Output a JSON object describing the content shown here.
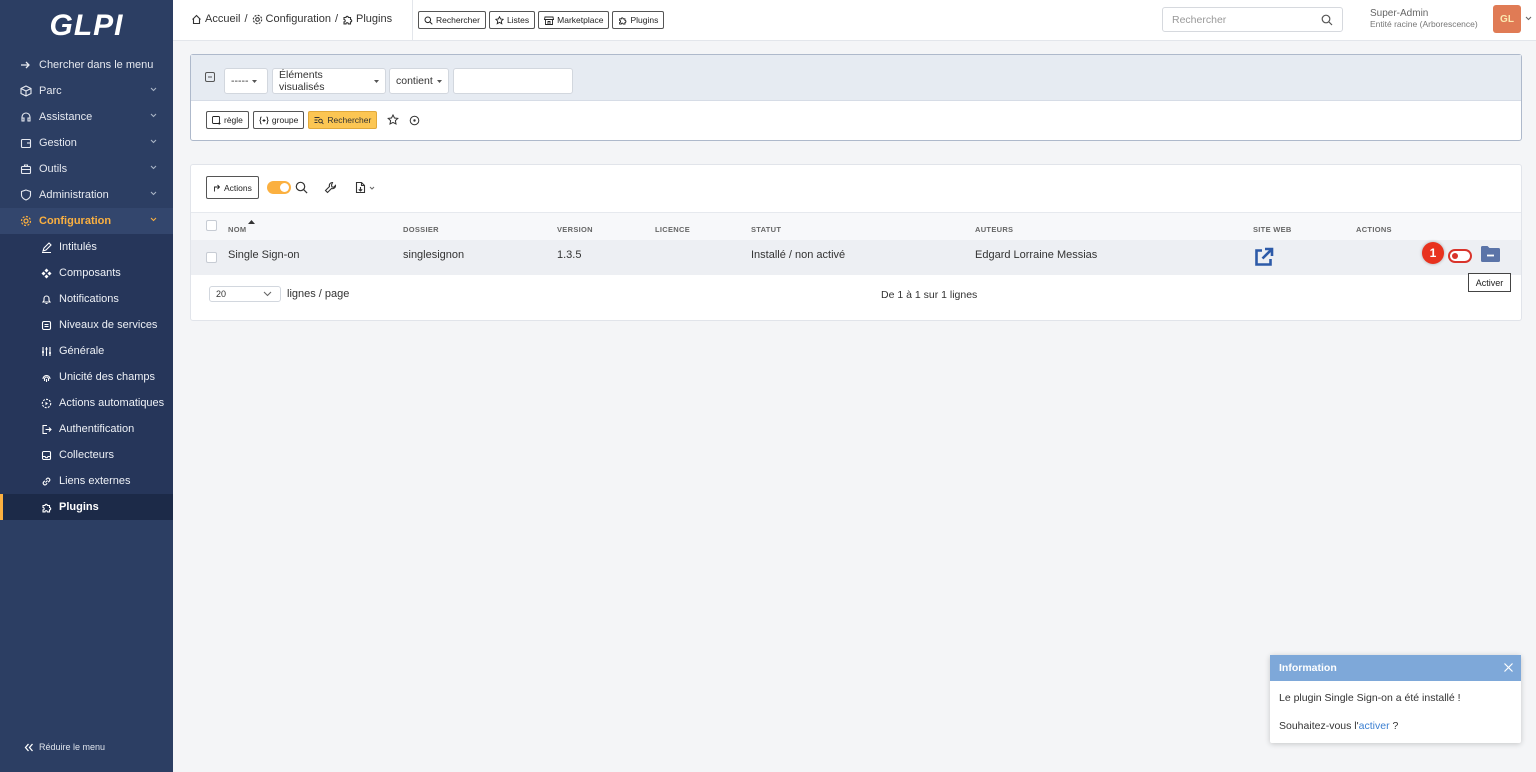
{
  "logo": "GLPI",
  "sidebar": {
    "items": [
      {
        "label": "Chercher dans le menu",
        "icon": "arrow-right-icon",
        "chev": false
      },
      {
        "label": "Parc",
        "icon": "box-icon",
        "chev": true
      },
      {
        "label": "Assistance",
        "icon": "headset-icon",
        "chev": true
      },
      {
        "label": "Gestion",
        "icon": "wallet-icon",
        "chev": true
      },
      {
        "label": "Outils",
        "icon": "briefcase-icon",
        "chev": true
      },
      {
        "label": "Administration",
        "icon": "shield-icon",
        "chev": true
      },
      {
        "label": "Configuration",
        "icon": "gear-icon",
        "chev": true
      }
    ],
    "subitems": [
      {
        "label": "Intitulés",
        "icon": "edit-icon"
      },
      {
        "label": "Composants",
        "icon": "components-icon"
      },
      {
        "label": "Notifications",
        "icon": "bell-icon"
      },
      {
        "label": "Niveaux de services",
        "icon": "checklist-icon"
      },
      {
        "label": "Générale",
        "icon": "sliders-icon"
      },
      {
        "label": "Unicité des champs",
        "icon": "fingerprint-icon"
      },
      {
        "label": "Actions automatiques",
        "icon": "settings-automation-icon"
      },
      {
        "label": "Authentification",
        "icon": "login-icon"
      },
      {
        "label": "Collecteurs",
        "icon": "inbox-icon"
      },
      {
        "label": "Liens externes",
        "icon": "link-icon"
      },
      {
        "label": "Plugins",
        "icon": "puzzle-icon"
      }
    ],
    "reduce_label": "Réduire le menu"
  },
  "breadcrumb": {
    "home": "Accueil",
    "sep1": "/",
    "config": "Configuration",
    "sep2": "/",
    "plugins": "Plugins"
  },
  "toolbar": {
    "search": "Rechercher",
    "lists": "Listes",
    "marketplace": "Marketplace",
    "plugins": "Plugins"
  },
  "global_search": {
    "placeholder": "Rechercher"
  },
  "user": {
    "name": "Super-Admin",
    "entity": "Entité racine (Arborescence)",
    "initials": "GL"
  },
  "filter": {
    "field_select": "-----",
    "items_select": "Éléments visualisés",
    "op_select": "contient",
    "value": "",
    "rule_button": "règle",
    "group_button": "groupe",
    "search_button": "Rechercher"
  },
  "list": {
    "actions_label": "Actions",
    "columns": [
      "Nom",
      "Dossier",
      "Version",
      "Licence",
      "Statut",
      "Auteurs",
      "Site web",
      "Actions"
    ],
    "rows": [
      {
        "nom": "Single Sign-on",
        "dossier": "singlesignon",
        "version": "1.3.5",
        "licence": "",
        "statut": "Installé / non activé",
        "auteurs": "Edgard Lorraine Messias"
      }
    ],
    "page_size": "20",
    "lines_label": "lignes / page",
    "count_info": "De 1 à 1 sur 1 lignes"
  },
  "annotation_badge": "1",
  "tooltip": "Activer",
  "toast": {
    "title": "Information",
    "message": "Le plugin Single Sign-on a été installé !",
    "question_prefix": "Souhaitez-vous l'",
    "question_link": "activer",
    "question_suffix": " ?"
  },
  "colors": {
    "sidebar_bg": "#2c3e63",
    "active_menu": "#fbb040",
    "primary_button": "#fcc653",
    "toast_header": "#7ea8d9",
    "deactivated_toggle": "#d9342b",
    "folder_icon": "#5b74a8",
    "link_icon": "#2d5aa8"
  }
}
